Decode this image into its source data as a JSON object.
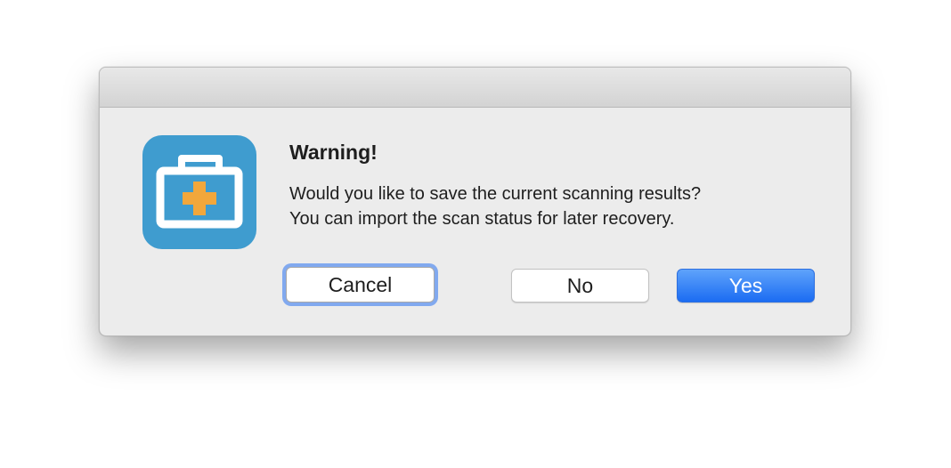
{
  "dialog": {
    "title": "Warning!",
    "message_lines": [
      "Would you like to save the current scanning results?",
      "You can import the scan status for later recovery."
    ],
    "icon": "medical-kit-icon"
  },
  "buttons": {
    "cancel": "Cancel",
    "no": "No",
    "yes": "Yes"
  },
  "colors": {
    "icon_background": "#3f9ccf",
    "icon_cross": "#f2a73b",
    "default_button": "#2f7cf6",
    "focus_ring": "#6e9ef0"
  }
}
